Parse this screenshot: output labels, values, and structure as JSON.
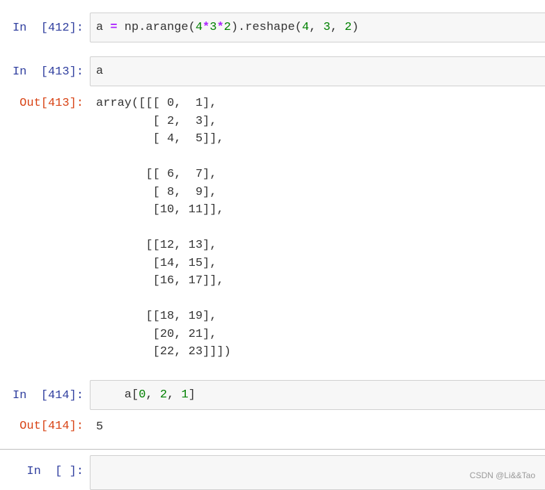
{
  "cells": [
    {
      "prompt": "In  [412]:",
      "code": [
        "a ",
        "=",
        " np.arange(",
        "4",
        "*",
        "3",
        "*",
        "2",
        ").reshape(",
        "4",
        ", ",
        "3",
        ", ",
        "2",
        ")"
      ]
    },
    {
      "prompt": "In  [413]:",
      "code": "a",
      "out_prompt": "Out[413]:",
      "output": [
        "array([[[ 0,  1],",
        "        [ 2,  3],",
        "        [ 4,  5]],",
        "",
        "       [[ 6,  7],",
        "        [ 8,  9],",
        "        [10, 11]],",
        "",
        "       [[12, 13],",
        "        [14, 15],",
        "        [16, 17]],",
        "",
        "       [[18, 19],",
        "        [20, 21],",
        "        [22, 23]]])"
      ]
    },
    {
      "prompt": "In  [414]:",
      "code": [
        "    a[",
        "0",
        ", ",
        "2",
        ", ",
        "1",
        "]"
      ],
      "out_prompt": "Out[414]:",
      "output": "5"
    },
    {
      "prompt": "In  [ ]:",
      "code": ""
    }
  ],
  "watermark": "CSDN @Li&&Tao",
  "colors": {
    "in_prompt": "#303f9f",
    "out_prompt": "#d84315",
    "number": "#008000",
    "operator": "#aa22ff"
  }
}
